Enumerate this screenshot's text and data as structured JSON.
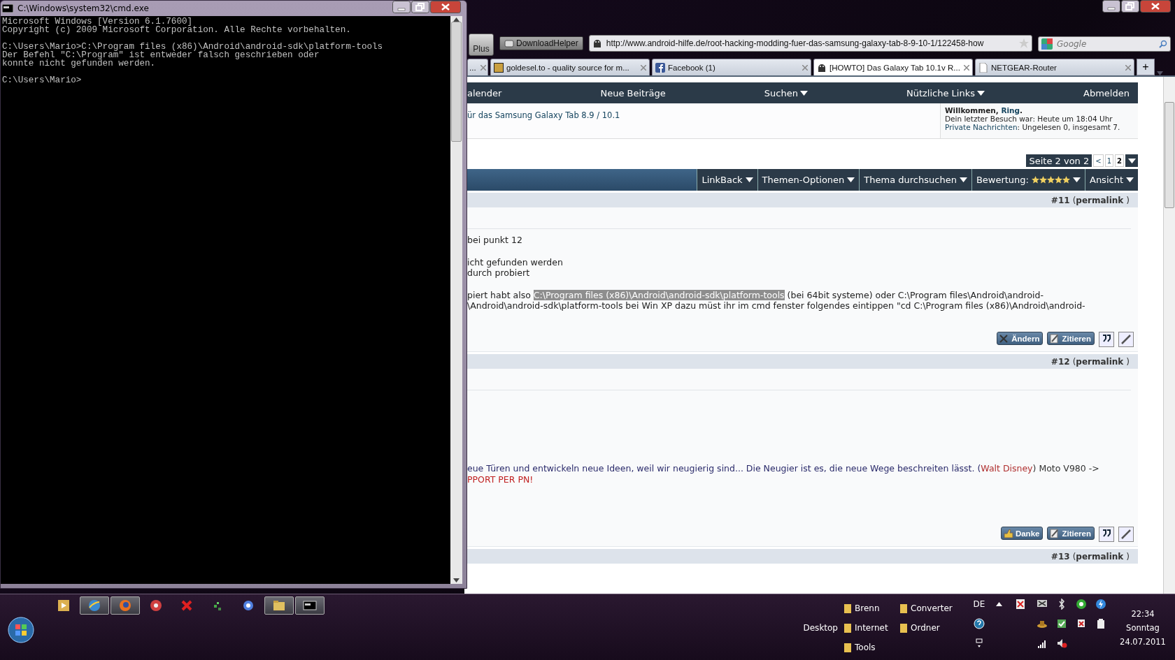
{
  "cmd_window": {
    "title": "C:\\Windows\\system32\\cmd.exe",
    "blocks": [
      [
        "Microsoft Windows [Version 6.1.7600]",
        "Copyright (c) 2009 Microsoft Corporation. Alle Rechte vorbehalten."
      ],
      [
        "C:\\Users\\Mario>C:\\Program files (x86)\\Android\\android-sdk\\platform-tools",
        "Der Befehl \"C:\\Program\" ist entweder falsch geschrieben oder",
        "konnte nicht gefunden werden."
      ],
      [
        "C:\\Users\\Mario>"
      ]
    ]
  },
  "browser": {
    "toolbar": {
      "plus_button": "Plus",
      "addon_button": "DownloadHelper",
      "url": "http://www.android-hilfe.de/root-hacking-modding-fuer-das-samsung-galaxy-tab-8-9-10-1/122458-how",
      "search_placeholder": "Google"
    },
    "tabs": [
      {
        "label": "...",
        "kind": "none",
        "selected": false
      },
      {
        "label": "goldesel.to - quality source for m...",
        "kind": "ge",
        "selected": false
      },
      {
        "label": "Facebook (1)",
        "kind": "facebook",
        "selected": false
      },
      {
        "label": "[HOWTO] Das Galaxy Tab 10.1v R...",
        "kind": "android",
        "selected": true
      },
      {
        "label": "NETGEAR-Router",
        "kind": "page",
        "selected": false
      }
    ],
    "new_tab_button": "+",
    "forum": {
      "nav": [
        {
          "label": "alender",
          "has_menu": false
        },
        {
          "label": "Neue Beiträge",
          "has_menu": false
        },
        {
          "label": "Suchen",
          "has_menu": true
        },
        {
          "label": "Nützliche Links",
          "has_menu": true
        },
        {
          "label": "Abmelden",
          "has_menu": false
        }
      ],
      "breadcrumb_link": "ür das Samsung Galaxy Tab 8.9 / 10.1",
      "welcome": {
        "greeting": "Willkommen, ",
        "user": "Ring",
        "greeting_end": ".",
        "last_visit": "Dein letzter Besuch war: Heute um 18:04 Uhr",
        "messages_link": "Private Nachrichten",
        "messages_text": ": Ungelesen 0, insgesamt 7."
      },
      "pagination": {
        "label": "Seite 2 von 2",
        "prev": "<",
        "pages": [
          {
            "label": "1",
            "selected": false
          },
          {
            "label": "2",
            "selected": true
          }
        ]
      },
      "thread_tools": [
        {
          "label": "LinkBack",
          "kind": "menu"
        },
        {
          "label": "Themen-Optionen",
          "kind": "menu"
        },
        {
          "label": "Thema durchsuchen",
          "kind": "menu"
        },
        {
          "label": "Bewertung:",
          "kind": "rating",
          "stars": 5
        },
        {
          "label": "Ansicht",
          "kind": "menu"
        }
      ],
      "posts": [
        {
          "number": "#11",
          "permalink": "(**permalink**)",
          "blocks": [
            [
              [
                {
                  "text": "bei punkt 12"
                }
              ]
            ],
            [
              [
                {
                  "text": "icht gefunden werden"
                }
              ],
              [
                {
                  "text": "durch probiert"
                }
              ]
            ],
            [
              [
                {
                  "text": "piert habt also "
                },
                {
                  "text": "C:\\Program files (x86)\\Android\\android-sdk\\platform-tools",
                  "highlighted": true
                },
                {
                  "text": " (bei 64bit systeme) oder C:\\Program files\\Android\\android-"
                }
              ],
              [
                {
                  "text": "\\Android\\android-sdk\\platform-tools bei Win XP dazu müst ihr im cmd fenster folgendes eintippen \"cd C:\\Program files (x86)\\Android\\android-"
                }
              ]
            ]
          ],
          "actions": [
            {
              "kind": "edit",
              "label": "Ändern"
            },
            {
              "kind": "quote",
              "label": "Zitieren"
            },
            {
              "kind": "multiquote"
            },
            {
              "kind": "quick-reply"
            }
          ]
        },
        {
          "number": "#12",
          "permalink": "(**permalink**)",
          "blocks": [
            [
              [
                {
                  "text": "eue Türen und entwickeln neue Ideen, weil wir neugierig sind... Die Neugier ist es, die neue Wege beschreiten lässt. (",
                  "color": "#2b2b6b"
                },
                {
                  "text": "Walt Disney",
                  "color": "#b03030"
                },
                {
                  "text": ") Moto V980 ->",
                  "color": "#333333"
                }
              ],
              [
                {
                  "text": "PPORT PER PN!",
                  "color": "#c02020"
                }
              ]
            ]
          ],
          "actions": [
            {
              "kind": "thanks",
              "label": "Danke"
            },
            {
              "kind": "quote",
              "label": "Zitieren"
            },
            {
              "kind": "multiquote"
            },
            {
              "kind": "quick-reply"
            }
          ]
        },
        {
          "number": "#13",
          "permalink": "(**permalink**)"
        }
      ]
    }
  },
  "taskbar": {
    "pinned": [
      {
        "kind": "media",
        "open": false
      },
      {
        "kind": "ie",
        "open": true
      },
      {
        "kind": "firefox",
        "open": true
      },
      {
        "kind": "disc",
        "open": false
      },
      {
        "kind": "cross",
        "open": false
      },
      {
        "kind": "pixels",
        "open": false
      },
      {
        "kind": "music",
        "open": false
      },
      {
        "kind": "explorer",
        "open": true
      },
      {
        "kind": "cmd",
        "open": true
      }
    ],
    "toolbar_label": "Desktop",
    "folders": [
      "Brenn",
      "Converter",
      "Internet",
      "Ordner",
      "Tools"
    ],
    "language": "DE",
    "clock": {
      "time": "22:34",
      "day": "Sonntag",
      "date": "24.07.2011"
    }
  }
}
